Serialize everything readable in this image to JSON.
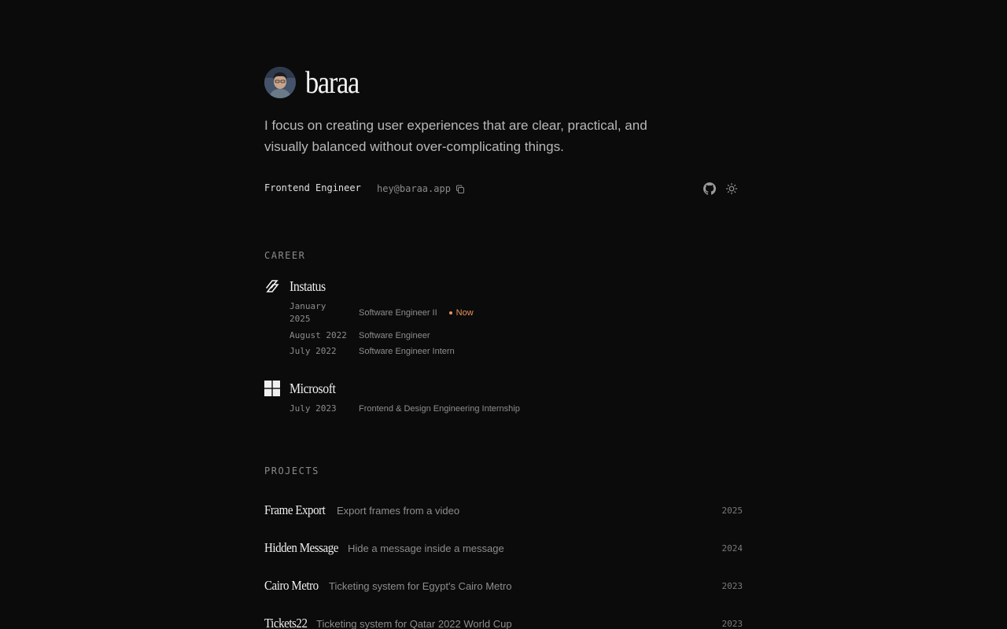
{
  "profile": {
    "name": "baraa",
    "tagline": "I focus on creating user experiences that are clear, practical, and visually balanced without over-complicating things.",
    "role": "Frontend Engineer",
    "email": "hey@baraa.app"
  },
  "icons": {
    "copy": "copy-icon",
    "github": "github-icon",
    "theme": "sun-icon"
  },
  "colors": {
    "background": "#0b0b0c",
    "accent": "#e9925a"
  },
  "career": {
    "label": "CAREER",
    "companies": [
      {
        "name": "Instatus",
        "roles": [
          {
            "date_line1": "January",
            "date_line2": "2025",
            "title": "Software Engineer II",
            "badge": "Now"
          },
          {
            "date": "August 2022",
            "title": "Software Engineer"
          },
          {
            "date": "July 2022",
            "title": "Software Engineer Intern"
          }
        ]
      },
      {
        "name": "Microsoft",
        "roles": [
          {
            "date": "July 2023",
            "title": "Frontend & Design Engineering Internship"
          }
        ]
      }
    ]
  },
  "projects": {
    "label": "PROJECTS",
    "items": [
      {
        "name": "Frame Export",
        "description": "Export frames from a video",
        "year": "2025"
      },
      {
        "name": "Hidden Message",
        "description": "Hide a message inside a message",
        "year": "2024"
      },
      {
        "name": "Cairo Metro",
        "description": "Ticketing system for Egypt's Cairo Metro",
        "year": "2023"
      },
      {
        "name": "Tickets22",
        "description": "Ticketing system for Qatar 2022 World Cup",
        "year": "2023"
      }
    ]
  }
}
